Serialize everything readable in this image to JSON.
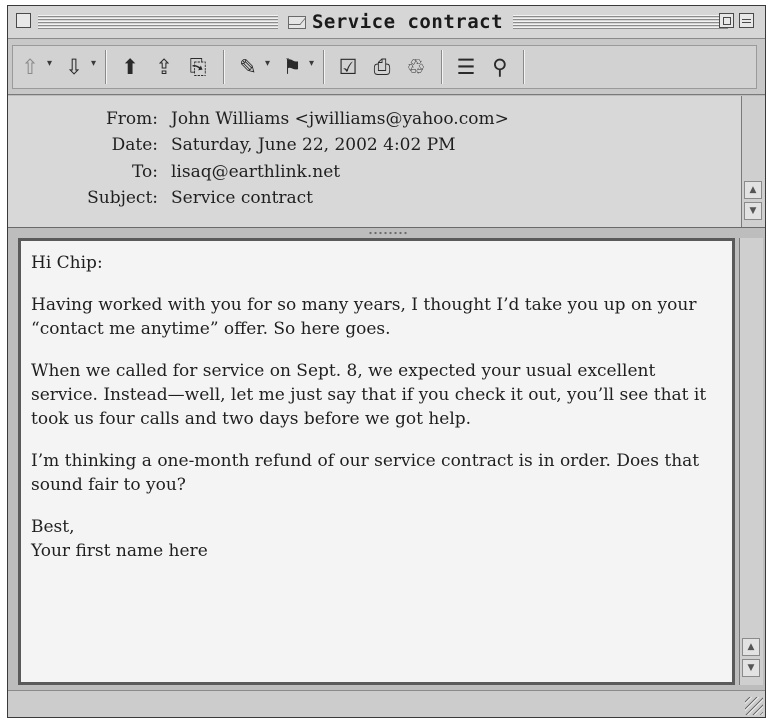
{
  "window": {
    "title": "Service contract"
  },
  "toolbar": {
    "icons": [
      "arrow-up-icon",
      "arrow-down-icon",
      "reply-icon",
      "reply-all-icon",
      "forward-icon",
      "paperclip-icon",
      "flag-icon",
      "edit-icon",
      "print-icon",
      "trash-icon",
      "list-icon",
      "find-icon"
    ]
  },
  "header": {
    "from_label": "From:",
    "from_value": "John Williams <jwilliams@yahoo.com>",
    "date_label": "Date:",
    "date_value": "Saturday, June 22, 2002 4:02 PM",
    "to_label": "To:",
    "to_value": "lisaq@earthlink.net",
    "subject_label": "Subject:",
    "subject_value": "Service contract"
  },
  "message": {
    "p1": "Hi Chip:",
    "p2": "Having worked with you for so many years, I thought I’d take you up on your “contact me anytime” offer. So here goes.",
    "p3": "When we called for service on Sept. 8, we expected your usual excellent service. Instead—well, let me just say that if you check it out, you’ll see that it took us four calls and two days before we got help.",
    "p4": "I’m thinking a one-month refund of our service contract is in order. Does that sound fair to you?",
    "p5_line1": "Best,",
    "p5_line2": "Your first name here"
  }
}
